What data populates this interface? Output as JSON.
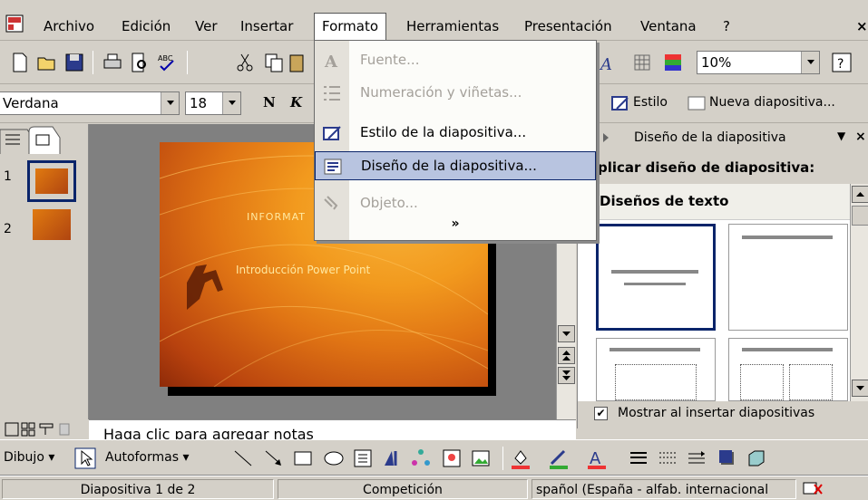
{
  "menubar": {
    "items": [
      "Archivo",
      "Edición",
      "Ver",
      "Insertar",
      "Formato",
      "Herramientas",
      "Presentación",
      "Ventana",
      "?"
    ],
    "active": "Formato"
  },
  "toolbar": {
    "zoom": "10%"
  },
  "format_bar": {
    "font": "Verdana",
    "size": "18",
    "bold_label": "N",
    "italic_label": "K",
    "style_label": "Estilo",
    "new_slide_label": "Nueva diapositiva..."
  },
  "format_menu": {
    "items": [
      {
        "label": "Fuente...",
        "icon": "font-A-icon",
        "disabled": true
      },
      {
        "label": "Numeración y viñetas...",
        "icon": "bullets-icon",
        "disabled": true
      },
      {
        "label": "Estilo de la diapositiva...",
        "icon": "slide-style-icon",
        "disabled": false
      },
      {
        "label": "Diseño de la diapositiva...",
        "icon": "slide-layout-icon",
        "disabled": false,
        "highlighted": true
      },
      {
        "label": "Objeto...",
        "icon": "object-icon",
        "disabled": true
      }
    ],
    "expand": "»"
  },
  "slide": {
    "title": "INFORMAT",
    "subtitle": "Introducción Power Point"
  },
  "thumbnails": [
    "1",
    "2"
  ],
  "task_pane": {
    "header": "Diseño de la diapositiva",
    "apply_title": "plicar diseño de diapositiva:",
    "section": "Diseños de texto",
    "checkbox_label": "Mostrar al insertar diapositivas",
    "checkbox_checked": true
  },
  "notes": {
    "placeholder": "Haga clic para agregar notas"
  },
  "drawing": {
    "draw_label": "Dibujo",
    "autoshapes_label": "Autoformas"
  },
  "status": {
    "slide": "Diapositiva 1 de 2",
    "design": "Competición",
    "language": "spañol (España - alfab. internacional"
  },
  "colors": {
    "menu_highlight": "#b8c4e0",
    "selection_border": "#0a246a",
    "slide_orange": "#f29a1e"
  }
}
